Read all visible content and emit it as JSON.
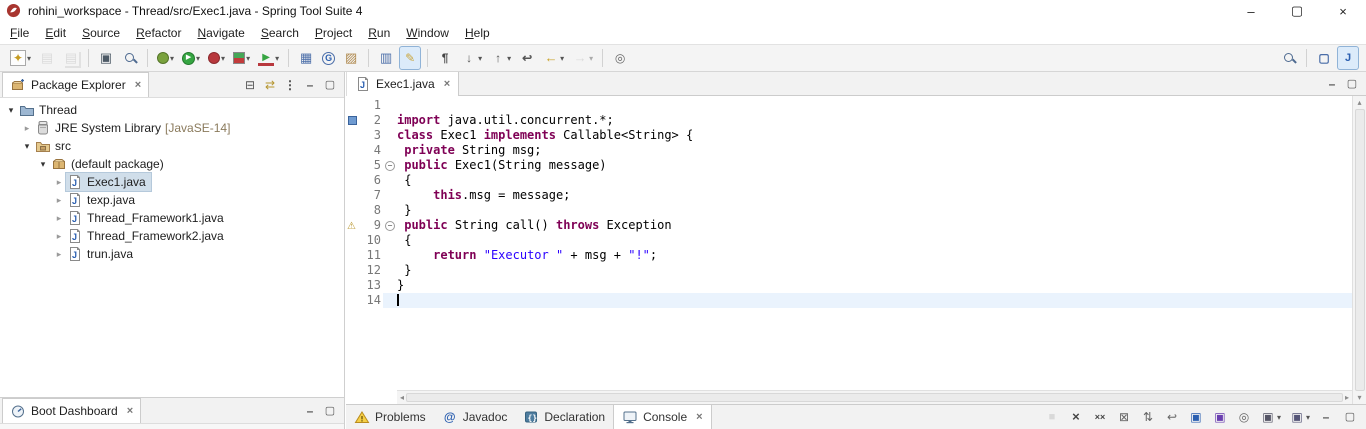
{
  "window": {
    "title": "rohini_workspace - Thread/src/Exec1.java - Spring Tool Suite 4",
    "controls": [
      {
        "name": "minimize-window",
        "glyph": "–"
      },
      {
        "name": "maximize-window",
        "glyph": "▢"
      },
      {
        "name": "close-window",
        "glyph": "×"
      }
    ]
  },
  "glyphs": {
    "close_tab": "×",
    "dropdown": "▾",
    "expanded": "▾",
    "collapsed": "▸",
    "fold_collapse": "−",
    "scroll_up": "▴",
    "scroll_down": "▾",
    "scroll_left": "◂",
    "scroll_right": "▸"
  },
  "colors": {
    "keyword": "#7f0055",
    "string": "#2a00ff",
    "current_line": "#eaf3fd",
    "selection": "#d0deea"
  },
  "menu_bar": {
    "items": [
      "File",
      "Edit",
      "Source",
      "Refactor",
      "Navigate",
      "Search",
      "Project",
      "Run",
      "Window",
      "Help"
    ]
  },
  "toolbar": {
    "groups": [
      [
        {
          "name": "new-wizard",
          "dropdown": true
        },
        {
          "name": "save",
          "disabled": true
        },
        {
          "name": "save-all",
          "disabled": true
        }
      ],
      [
        {
          "name": "print"
        },
        {
          "name": "open-search"
        }
      ],
      [
        {
          "name": "debug",
          "dropdown": true
        },
        {
          "name": "run",
          "dropdown": true
        },
        {
          "name": "profile",
          "dropdown": true
        },
        {
          "name": "coverage",
          "dropdown": true
        },
        {
          "name": "external-tools",
          "dropdown": true
        }
      ],
      [
        {
          "name": "new-servlet"
        },
        {
          "name": "new-web-service"
        },
        {
          "name": "open-archive"
        }
      ],
      [
        {
          "name": "toggle-block-selection"
        },
        {
          "name": "toggle-mark-occurrences",
          "active": true
        }
      ],
      [
        {
          "name": "show-whitespace"
        },
        {
          "name": "next-annotation",
          "dropdown": true
        },
        {
          "name": "previous-annotation",
          "dropdown": true
        },
        {
          "name": "last-edit-location"
        },
        {
          "name": "back",
          "dropdown": true
        },
        {
          "name": "forward",
          "dropdown": true,
          "disabled": true
        }
      ],
      [
        {
          "name": "pin-editor"
        }
      ]
    ],
    "right": [
      {
        "name": "quick-access-search"
      },
      {
        "name": "open-perspective"
      },
      {
        "name": "java-perspective",
        "active": true
      }
    ]
  },
  "package_explorer": {
    "title": "Package Explorer",
    "header_icons": [
      {
        "name": "collapse-all"
      },
      {
        "name": "link-with-editor"
      },
      {
        "name": "view-menu"
      },
      {
        "name": "minimize-view"
      },
      {
        "name": "maximize-view"
      }
    ],
    "tree": [
      {
        "label": "Thread",
        "icon": "project",
        "depth": 0,
        "expanded": true
      },
      {
        "label": "JRE System Library",
        "suffix": " [JavaSE-14]",
        "icon": "library",
        "depth": 1,
        "expanded": false
      },
      {
        "label": "src",
        "icon": "src-folder",
        "depth": 1,
        "expanded": true
      },
      {
        "label": "(default package)",
        "icon": "package",
        "depth": 2,
        "expanded": true
      },
      {
        "label": "Exec1.java",
        "icon": "java-file",
        "depth": 3,
        "expanded": false,
        "selected": true
      },
      {
        "label": "texp.java",
        "icon": "java-file",
        "depth": 3,
        "expanded": false
      },
      {
        "label": "Thread_Framework1.java",
        "icon": "java-file",
        "depth": 3,
        "expanded": false
      },
      {
        "label": "Thread_Framework2.java",
        "icon": "java-file",
        "depth": 3,
        "expanded": false
      },
      {
        "label": "trun.java",
        "icon": "java-file",
        "depth": 3,
        "expanded": false
      }
    ]
  },
  "editor": {
    "tab": {
      "label": "Exec1.java",
      "icon": "java-file"
    },
    "lines": [
      {
        "n": "1",
        "segs": []
      },
      {
        "n": "2",
        "ruler": "occurrence-marker",
        "segs": [
          {
            "t": "k",
            "s": "import"
          },
          {
            "t": "p",
            "s": " java.util.concurrent.*;"
          }
        ]
      },
      {
        "n": "3",
        "segs": [
          {
            "t": "k",
            "s": "class"
          },
          {
            "t": "p",
            "s": " Exec1 "
          },
          {
            "t": "k",
            "s": "implements"
          },
          {
            "t": "p",
            "s": " Callable<String> {"
          }
        ]
      },
      {
        "n": "4",
        "segs": [
          {
            "t": "p",
            "s": " "
          },
          {
            "t": "k",
            "s": "private"
          },
          {
            "t": "p",
            "s": " String msg;"
          }
        ]
      },
      {
        "n": "5",
        "fold": true,
        "segs": [
          {
            "t": "p",
            "s": " "
          },
          {
            "t": "k",
            "s": "public"
          },
          {
            "t": "p",
            "s": " Exec1(String message)"
          }
        ]
      },
      {
        "n": "6",
        "segs": [
          {
            "t": "p",
            "s": " {"
          }
        ]
      },
      {
        "n": "7",
        "segs": [
          {
            "t": "p",
            "s": "     "
          },
          {
            "t": "k",
            "s": "this"
          },
          {
            "t": "p",
            "s": ".msg = message;"
          }
        ]
      },
      {
        "n": "8",
        "segs": [
          {
            "t": "p",
            "s": " }"
          }
        ]
      },
      {
        "n": "9",
        "fold": true,
        "ruler": "warning-marker",
        "segs": [
          {
            "t": "p",
            "s": " "
          },
          {
            "t": "k",
            "s": "public"
          },
          {
            "t": "p",
            "s": " String call() "
          },
          {
            "t": "k",
            "s": "throws"
          },
          {
            "t": "p",
            "s": " Exception"
          }
        ]
      },
      {
        "n": "10",
        "segs": [
          {
            "t": "p",
            "s": " {"
          }
        ]
      },
      {
        "n": "11",
        "segs": [
          {
            "t": "p",
            "s": "     "
          },
          {
            "t": "k",
            "s": "return"
          },
          {
            "t": "p",
            "s": " "
          },
          {
            "t": "s",
            "s": "\"Executor \""
          },
          {
            "t": "p",
            "s": " + msg + "
          },
          {
            "t": "s",
            "s": "\"!\""
          },
          {
            "t": "p",
            "s": ";"
          }
        ]
      },
      {
        "n": "12",
        "segs": [
          {
            "t": "p",
            "s": " }"
          }
        ]
      },
      {
        "n": "13",
        "segs": [
          {
            "t": "p",
            "s": "}"
          }
        ]
      },
      {
        "n": "14",
        "current": true,
        "cursor": true,
        "segs": []
      }
    ]
  },
  "boot_dashboard": {
    "title": "Boot Dashboard",
    "header_icons": [
      {
        "name": "minimize-view"
      },
      {
        "name": "maximize-view"
      }
    ]
  },
  "console_area": {
    "tabs": [
      {
        "label": "Problems",
        "icon": "problems"
      },
      {
        "label": "Javadoc",
        "icon": "javadoc"
      },
      {
        "label": "Declaration",
        "icon": "declaration"
      },
      {
        "label": "Console",
        "icon": "console",
        "active": true
      }
    ],
    "toolbar": [
      {
        "name": "terminate",
        "disabled": true
      },
      {
        "name": "remove-launch"
      },
      {
        "name": "remove-all-terminated"
      },
      {
        "name": "clear-console"
      },
      {
        "name": "scroll-lock"
      },
      {
        "name": "word-wrap"
      },
      {
        "name": "show-console-stdout"
      },
      {
        "name": "show-console-stderr"
      },
      {
        "name": "pin-console"
      },
      {
        "name": "display-selected-console",
        "dropdown": true
      },
      {
        "name": "open-console",
        "dropdown": true
      },
      {
        "name": "minimize-view"
      },
      {
        "name": "maximize-view"
      }
    ]
  }
}
